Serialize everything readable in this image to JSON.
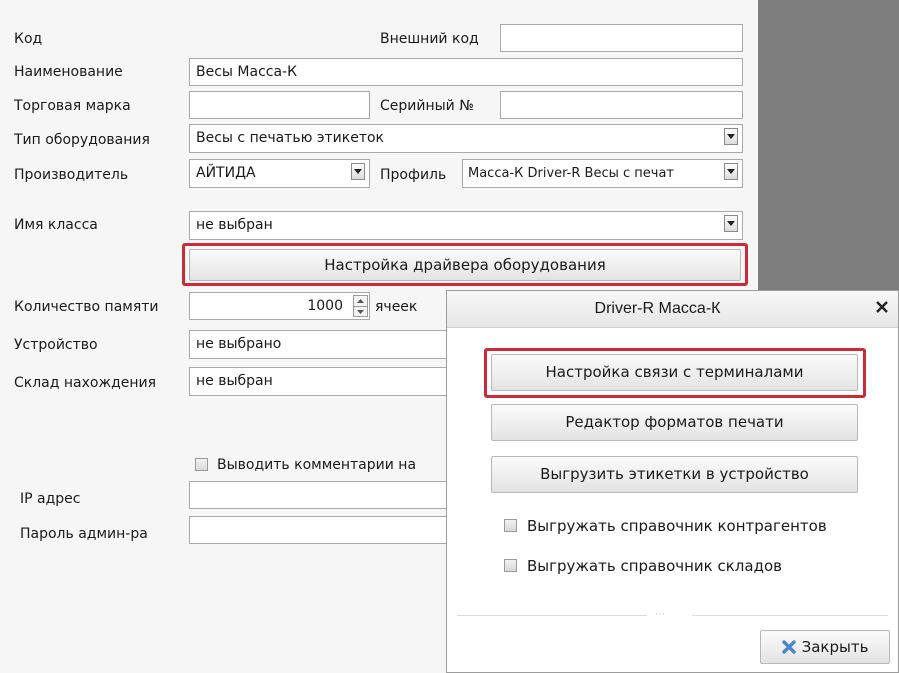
{
  "form": {
    "code_label": "Код",
    "external_code_label": "Внешний код",
    "external_code_value": "",
    "name_label": "Наименование",
    "name_value": "Весы Масса-К",
    "brand_label": "Торговая марка",
    "brand_value": "",
    "serial_label": "Серийный №",
    "serial_value": "",
    "equipment_type_label": "Тип оборудования",
    "equipment_type_value": "Весы с печатью этикеток",
    "manufacturer_label": "Производитель",
    "manufacturer_value": "АЙТИДА",
    "profile_label": "Профиль",
    "profile_value": "Масса-К Driver-R Весы с печат",
    "class_name_label": "Имя класса",
    "class_name_value": "не выбран",
    "driver_settings_button": "Настройка драйвера оборудования",
    "memory_label": "Количество памяти",
    "memory_value": "1000",
    "memory_unit": "ячеек",
    "device_label": "Устройство",
    "device_value": "не выбрано",
    "warehouse_label": "Склад нахождения",
    "warehouse_value": "не выбран",
    "comments_checkbox_label": "Выводить комментарии на",
    "ip_label": "IP адрес",
    "ip_value": "",
    "admin_password_label": "Пароль админ-ра",
    "admin_password_value": ""
  },
  "dialog": {
    "title": "Driver-R Масса-К",
    "terminal_link_button": "Настройка связи с терминалами",
    "print_format_editor_button": "Редактор форматов печати",
    "upload_labels_button": "Выгрузить этикетки в устройство",
    "upload_contractors_label": "Выгружать справочник контрагентов",
    "upload_warehouses_label": "Выгружать справочник складов",
    "close_button": "Закрыть"
  },
  "colors": {
    "highlight_frame": "#cc2a36",
    "background_gray": "#7d7d7d",
    "close_icon_blue": "#4a86c8"
  },
  "icons": {
    "dropdown": "chevron-down-icon",
    "close_dialog": "close-icon",
    "close_button": "blue-x-icon",
    "spinner": "spinner-arrows-icon"
  }
}
